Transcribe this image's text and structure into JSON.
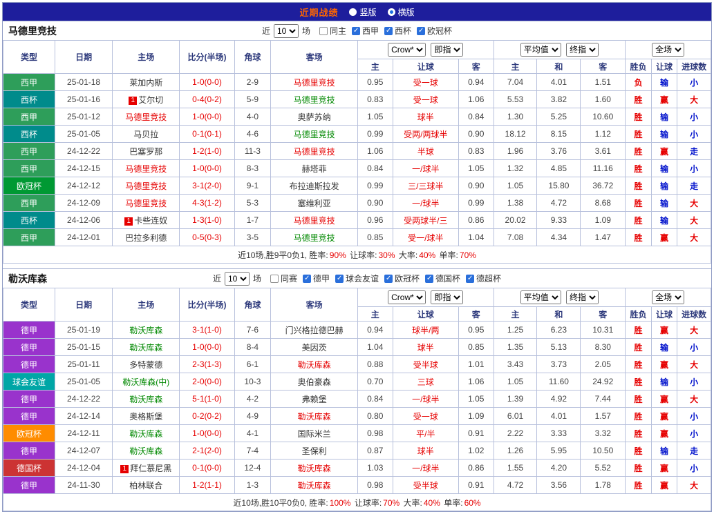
{
  "topbar": {
    "title": "近期战绩",
    "layout_options": [
      {
        "label": "竖版",
        "selected": false
      },
      {
        "label": "横版",
        "selected": true
      }
    ]
  },
  "table_columns": [
    "类型",
    "日期",
    "主场",
    "比分(半场)",
    "角球",
    "客场",
    "主",
    "让球",
    "客",
    "主",
    "和",
    "客",
    "胜负",
    "让球",
    "进球数"
  ],
  "accent_colors": {
    "topbar_bg": "#1e1e9c",
    "title_text": "#ff6600",
    "win_red": "#e60000",
    "loss_blue": "#0011cc",
    "team_green": "#008800",
    "grid_line": "#b7c0dc"
  },
  "sections": [
    {
      "team": "马德里竞技",
      "filters": {
        "prefix": "近",
        "count": "10",
        "suffix": "场",
        "options": [
          {
            "label": "同主",
            "checked": false
          },
          {
            "label": "西甲",
            "checked": true
          },
          {
            "label": "西杯",
            "checked": true
          },
          {
            "label": "欧冠杯",
            "checked": true
          }
        ]
      },
      "selects": {
        "bookmaker": "Crow*",
        "odds_phase": "即指",
        "avg": "平均值",
        "final": "终指",
        "scope": "全场"
      },
      "rows": [
        {
          "league": "西甲",
          "league_color": "#2e9e5a",
          "date": "25-01-18",
          "home": {
            "badge": "",
            "name": "莱加内斯",
            "c": "k"
          },
          "score": "1-0(0-0)",
          "corners": "2-9",
          "away": {
            "badge": "",
            "name": "马德里竞技",
            "c": "r"
          },
          "odds": [
            "0.95",
            "受一球",
            "0.94"
          ],
          "avg": [
            "7.04",
            "4.01",
            "1.51"
          ],
          "results": [
            {
              "t": "负",
              "c": "r"
            },
            {
              "t": "输",
              "c": "b"
            },
            {
              "t": "小",
              "c": "b"
            }
          ]
        },
        {
          "league": "西杯",
          "league_color": "#008b8b",
          "date": "25-01-16",
          "home": {
            "badge": "1",
            "name": "艾尔切",
            "c": "k"
          },
          "score": "0-4(0-2)",
          "corners": "5-9",
          "away": {
            "badge": "",
            "name": "马德里竞技",
            "c": "g"
          },
          "odds": [
            "0.83",
            "受一球",
            "1.06"
          ],
          "avg": [
            "5.53",
            "3.82",
            "1.60"
          ],
          "results": [
            {
              "t": "胜",
              "c": "r"
            },
            {
              "t": "赢",
              "c": "r"
            },
            {
              "t": "大",
              "c": "r"
            }
          ]
        },
        {
          "league": "西甲",
          "league_color": "#2e9e5a",
          "date": "25-01-12",
          "home": {
            "badge": "",
            "name": "马德里竞技",
            "c": "r"
          },
          "score": "1-0(0-0)",
          "corners": "4-0",
          "away": {
            "badge": "",
            "name": "奥萨苏纳",
            "c": "k"
          },
          "odds": [
            "1.05",
            "球半",
            "0.84"
          ],
          "avg": [
            "1.30",
            "5.25",
            "10.60"
          ],
          "results": [
            {
              "t": "胜",
              "c": "r"
            },
            {
              "t": "输",
              "c": "b"
            },
            {
              "t": "小",
              "c": "b"
            }
          ]
        },
        {
          "league": "西杯",
          "league_color": "#008b8b",
          "date": "25-01-05",
          "home": {
            "badge": "",
            "name": "马贝拉",
            "c": "k"
          },
          "score": "0-1(0-1)",
          "corners": "4-6",
          "away": {
            "badge": "",
            "name": "马德里竞技",
            "c": "g"
          },
          "odds": [
            "0.99",
            "受两/两球半",
            "0.90"
          ],
          "avg": [
            "18.12",
            "8.15",
            "1.12"
          ],
          "results": [
            {
              "t": "胜",
              "c": "r"
            },
            {
              "t": "输",
              "c": "b"
            },
            {
              "t": "小",
              "c": "b"
            }
          ]
        },
        {
          "league": "西甲",
          "league_color": "#2e9e5a",
          "date": "24-12-22",
          "home": {
            "badge": "",
            "name": "巴塞罗那",
            "c": "k"
          },
          "score": "1-2(1-0)",
          "corners": "11-3",
          "away": {
            "badge": "",
            "name": "马德里竞技",
            "c": "r"
          },
          "odds": [
            "1.06",
            "半球",
            "0.83"
          ],
          "avg": [
            "1.96",
            "3.76",
            "3.61"
          ],
          "results": [
            {
              "t": "胜",
              "c": "r"
            },
            {
              "t": "赢",
              "c": "r"
            },
            {
              "t": "走",
              "c": "b"
            }
          ]
        },
        {
          "league": "西甲",
          "league_color": "#2e9e5a",
          "date": "24-12-15",
          "home": {
            "badge": "",
            "name": "马德里竞技",
            "c": "r"
          },
          "score": "1-0(0-0)",
          "corners": "8-3",
          "away": {
            "badge": "",
            "name": "赫塔菲",
            "c": "k"
          },
          "odds": [
            "0.84",
            "一/球半",
            "1.05"
          ],
          "avg": [
            "1.32",
            "4.85",
            "11.16"
          ],
          "results": [
            {
              "t": "胜",
              "c": "r"
            },
            {
              "t": "输",
              "c": "b"
            },
            {
              "t": "小",
              "c": "b"
            }
          ]
        },
        {
          "league": "欧冠杯",
          "league_color": "#009933",
          "date": "24-12-12",
          "home": {
            "badge": "",
            "name": "马德里竞技",
            "c": "r"
          },
          "score": "3-1(2-0)",
          "corners": "9-1",
          "away": {
            "badge": "",
            "name": "布拉迪斯拉发",
            "c": "k"
          },
          "odds": [
            "0.99",
            "三/三球半",
            "0.90"
          ],
          "avg": [
            "1.05",
            "15.80",
            "36.72"
          ],
          "results": [
            {
              "t": "胜",
              "c": "r"
            },
            {
              "t": "输",
              "c": "b"
            },
            {
              "t": "走",
              "c": "b"
            }
          ]
        },
        {
          "league": "西甲",
          "league_color": "#2e9e5a",
          "date": "24-12-09",
          "home": {
            "badge": "",
            "name": "马德里竞技",
            "c": "r"
          },
          "score": "4-3(1-2)",
          "corners": "5-3",
          "away": {
            "badge": "",
            "name": "塞维利亚",
            "c": "k"
          },
          "odds": [
            "0.90",
            "一/球半",
            "0.99"
          ],
          "avg": [
            "1.38",
            "4.72",
            "8.68"
          ],
          "results": [
            {
              "t": "胜",
              "c": "r"
            },
            {
              "t": "输",
              "c": "b"
            },
            {
              "t": "大",
              "c": "r"
            }
          ]
        },
        {
          "league": "西杯",
          "league_color": "#008b8b",
          "date": "24-12-06",
          "home": {
            "badge": "1",
            "name": "卡些连奴",
            "c": "k"
          },
          "score": "1-3(1-0)",
          "corners": "1-7",
          "away": {
            "badge": "",
            "name": "马德里竞技",
            "c": "r"
          },
          "odds": [
            "0.96",
            "受两球半/三",
            "0.86"
          ],
          "avg": [
            "20.02",
            "9.33",
            "1.09"
          ],
          "results": [
            {
              "t": "胜",
              "c": "r"
            },
            {
              "t": "输",
              "c": "b"
            },
            {
              "t": "大",
              "c": "r"
            }
          ]
        },
        {
          "league": "西甲",
          "league_color": "#2e9e5a",
          "date": "24-12-01",
          "home": {
            "badge": "",
            "name": "巴拉多利德",
            "c": "k"
          },
          "score": "0-5(0-3)",
          "corners": "3-5",
          "away": {
            "badge": "",
            "name": "马德里竞技",
            "c": "g"
          },
          "odds": [
            "0.85",
            "受一/球半",
            "1.04"
          ],
          "avg": [
            "7.08",
            "4.34",
            "1.47"
          ],
          "results": [
            {
              "t": "胜",
              "c": "r"
            },
            {
              "t": "赢",
              "c": "r"
            },
            {
              "t": "大",
              "c": "r"
            }
          ]
        }
      ],
      "summary": [
        {
          "t": "近10场,胜9平0负1, 胜率:",
          "c": "k"
        },
        {
          "t": "90%",
          "c": "r"
        },
        {
          "t": " 让球率:",
          "c": "k"
        },
        {
          "t": "30%",
          "c": "r"
        },
        {
          "t": " 大率:",
          "c": "k"
        },
        {
          "t": "40%",
          "c": "r"
        },
        {
          "t": " 单率:",
          "c": "k"
        },
        {
          "t": "70%",
          "c": "r"
        }
      ]
    },
    {
      "team": "勒沃库森",
      "filters": {
        "prefix": "近",
        "count": "10",
        "suffix": "场",
        "options": [
          {
            "label": "同赛",
            "checked": false
          },
          {
            "label": "德甲",
            "checked": true
          },
          {
            "label": "球会友谊",
            "checked": true
          },
          {
            "label": "欧冠杯",
            "checked": true
          },
          {
            "label": "德国杯",
            "checked": true
          },
          {
            "label": "德超杯",
            "checked": true
          }
        ]
      },
      "selects": {
        "bookmaker": "Crow*",
        "odds_phase": "即指",
        "avg": "平均值",
        "final": "终指",
        "scope": "全场"
      },
      "rows": [
        {
          "league": "德甲",
          "league_color": "#9933cc",
          "date": "25-01-19",
          "home": {
            "badge": "",
            "name": "勒沃库森",
            "c": "g"
          },
          "score": "3-1(1-0)",
          "corners": "7-6",
          "away": {
            "badge": "",
            "name": "门兴格拉德巴赫",
            "c": "k"
          },
          "odds": [
            "0.94",
            "球半/两",
            "0.95"
          ],
          "avg": [
            "1.25",
            "6.23",
            "10.31"
          ],
          "results": [
            {
              "t": "胜",
              "c": "r"
            },
            {
              "t": "赢",
              "c": "r"
            },
            {
              "t": "大",
              "c": "r"
            }
          ]
        },
        {
          "league": "德甲",
          "league_color": "#9933cc",
          "date": "25-01-15",
          "home": {
            "badge": "",
            "name": "勒沃库森",
            "c": "g"
          },
          "score": "1-0(0-0)",
          "corners": "8-4",
          "away": {
            "badge": "",
            "name": "美因茨",
            "c": "k"
          },
          "odds": [
            "1.04",
            "球半",
            "0.85"
          ],
          "avg": [
            "1.35",
            "5.13",
            "8.30"
          ],
          "results": [
            {
              "t": "胜",
              "c": "r"
            },
            {
              "t": "输",
              "c": "b"
            },
            {
              "t": "小",
              "c": "b"
            }
          ]
        },
        {
          "league": "德甲",
          "league_color": "#9933cc",
          "date": "25-01-11",
          "home": {
            "badge": "",
            "name": "多特蒙德",
            "c": "k"
          },
          "score": "2-3(1-3)",
          "corners": "6-1",
          "away": {
            "badge": "",
            "name": "勒沃库森",
            "c": "r"
          },
          "odds": [
            "0.88",
            "受半球",
            "1.01"
          ],
          "avg": [
            "3.43",
            "3.73",
            "2.05"
          ],
          "results": [
            {
              "t": "胜",
              "c": "r"
            },
            {
              "t": "赢",
              "c": "r"
            },
            {
              "t": "大",
              "c": "r"
            }
          ]
        },
        {
          "league": "球会友谊",
          "league_color": "#00a6a6",
          "date": "25-01-05",
          "home": {
            "badge": "",
            "name": "勒沃库森(中)",
            "c": "g"
          },
          "score": "2-0(0-0)",
          "corners": "10-3",
          "away": {
            "badge": "",
            "name": "奥伯豪森",
            "c": "k"
          },
          "odds": [
            "0.70",
            "三球",
            "1.06"
          ],
          "avg": [
            "1.05",
            "11.60",
            "24.92"
          ],
          "results": [
            {
              "t": "胜",
              "c": "r"
            },
            {
              "t": "输",
              "c": "b"
            },
            {
              "t": "小",
              "c": "b"
            }
          ]
        },
        {
          "league": "德甲",
          "league_color": "#9933cc",
          "date": "24-12-22",
          "home": {
            "badge": "",
            "name": "勒沃库森",
            "c": "g"
          },
          "score": "5-1(1-0)",
          "corners": "4-2",
          "away": {
            "badge": "",
            "name": "弗赖堡",
            "c": "k"
          },
          "odds": [
            "0.84",
            "一/球半",
            "1.05"
          ],
          "avg": [
            "1.39",
            "4.92",
            "7.44"
          ],
          "results": [
            {
              "t": "胜",
              "c": "r"
            },
            {
              "t": "赢",
              "c": "r"
            },
            {
              "t": "大",
              "c": "r"
            }
          ]
        },
        {
          "league": "德甲",
          "league_color": "#9933cc",
          "date": "24-12-14",
          "home": {
            "badge": "",
            "name": "奥格斯堡",
            "c": "k"
          },
          "score": "0-2(0-2)",
          "corners": "4-9",
          "away": {
            "badge": "",
            "name": "勒沃库森",
            "c": "r"
          },
          "odds": [
            "0.80",
            "受一球",
            "1.09"
          ],
          "avg": [
            "6.01",
            "4.01",
            "1.57"
          ],
          "results": [
            {
              "t": "胜",
              "c": "r"
            },
            {
              "t": "赢",
              "c": "r"
            },
            {
              "t": "小",
              "c": "b"
            }
          ]
        },
        {
          "league": "欧冠杯",
          "league_color": "#ff8c00",
          "date": "24-12-11",
          "home": {
            "badge": "",
            "name": "勒沃库森",
            "c": "g"
          },
          "score": "1-0(0-0)",
          "corners": "4-1",
          "away": {
            "badge": "",
            "name": "国际米兰",
            "c": "k"
          },
          "odds": [
            "0.98",
            "平/半",
            "0.91"
          ],
          "avg": [
            "2.22",
            "3.33",
            "3.32"
          ],
          "results": [
            {
              "t": "胜",
              "c": "r"
            },
            {
              "t": "赢",
              "c": "r"
            },
            {
              "t": "小",
              "c": "b"
            }
          ]
        },
        {
          "league": "德甲",
          "league_color": "#9933cc",
          "date": "24-12-07",
          "home": {
            "badge": "",
            "name": "勒沃库森",
            "c": "g"
          },
          "score": "2-1(2-0)",
          "corners": "7-4",
          "away": {
            "badge": "",
            "name": "圣保利",
            "c": "k"
          },
          "odds": [
            "0.87",
            "球半",
            "1.02"
          ],
          "avg": [
            "1.26",
            "5.95",
            "10.50"
          ],
          "results": [
            {
              "t": "胜",
              "c": "r"
            },
            {
              "t": "输",
              "c": "b"
            },
            {
              "t": "走",
              "c": "b"
            }
          ]
        },
        {
          "league": "德国杯",
          "league_color": "#cc3333",
          "date": "24-12-04",
          "home": {
            "badge": "1",
            "name": "拜仁慕尼黑",
            "c": "k"
          },
          "score": "0-1(0-0)",
          "corners": "12-4",
          "away": {
            "badge": "",
            "name": "勒沃库森",
            "c": "r"
          },
          "odds": [
            "1.03",
            "一/球半",
            "0.86"
          ],
          "avg": [
            "1.55",
            "4.20",
            "5.52"
          ],
          "results": [
            {
              "t": "胜",
              "c": "r"
            },
            {
              "t": "赢",
              "c": "r"
            },
            {
              "t": "小",
              "c": "b"
            }
          ]
        },
        {
          "league": "德甲",
          "league_color": "#9933cc",
          "date": "24-11-30",
          "home": {
            "badge": "",
            "name": "柏林联合",
            "c": "k"
          },
          "score": "1-2(1-1)",
          "corners": "1-3",
          "away": {
            "badge": "",
            "name": "勒沃库森",
            "c": "r"
          },
          "odds": [
            "0.98",
            "受半球",
            "0.91"
          ],
          "avg": [
            "4.72",
            "3.56",
            "1.78"
          ],
          "results": [
            {
              "t": "胜",
              "c": "r"
            },
            {
              "t": "赢",
              "c": "r"
            },
            {
              "t": "大",
              "c": "r"
            }
          ]
        }
      ],
      "summary": [
        {
          "t": "近10场,胜10平0负0, 胜率:",
          "c": "k"
        },
        {
          "t": "100%",
          "c": "r"
        },
        {
          "t": " 让球率:",
          "c": "k"
        },
        {
          "t": "70%",
          "c": "r"
        },
        {
          "t": " 大率:",
          "c": "k"
        },
        {
          "t": "40%",
          "c": "r"
        },
        {
          "t": " 单率:",
          "c": "k"
        },
        {
          "t": "60%",
          "c": "r"
        }
      ]
    }
  ]
}
